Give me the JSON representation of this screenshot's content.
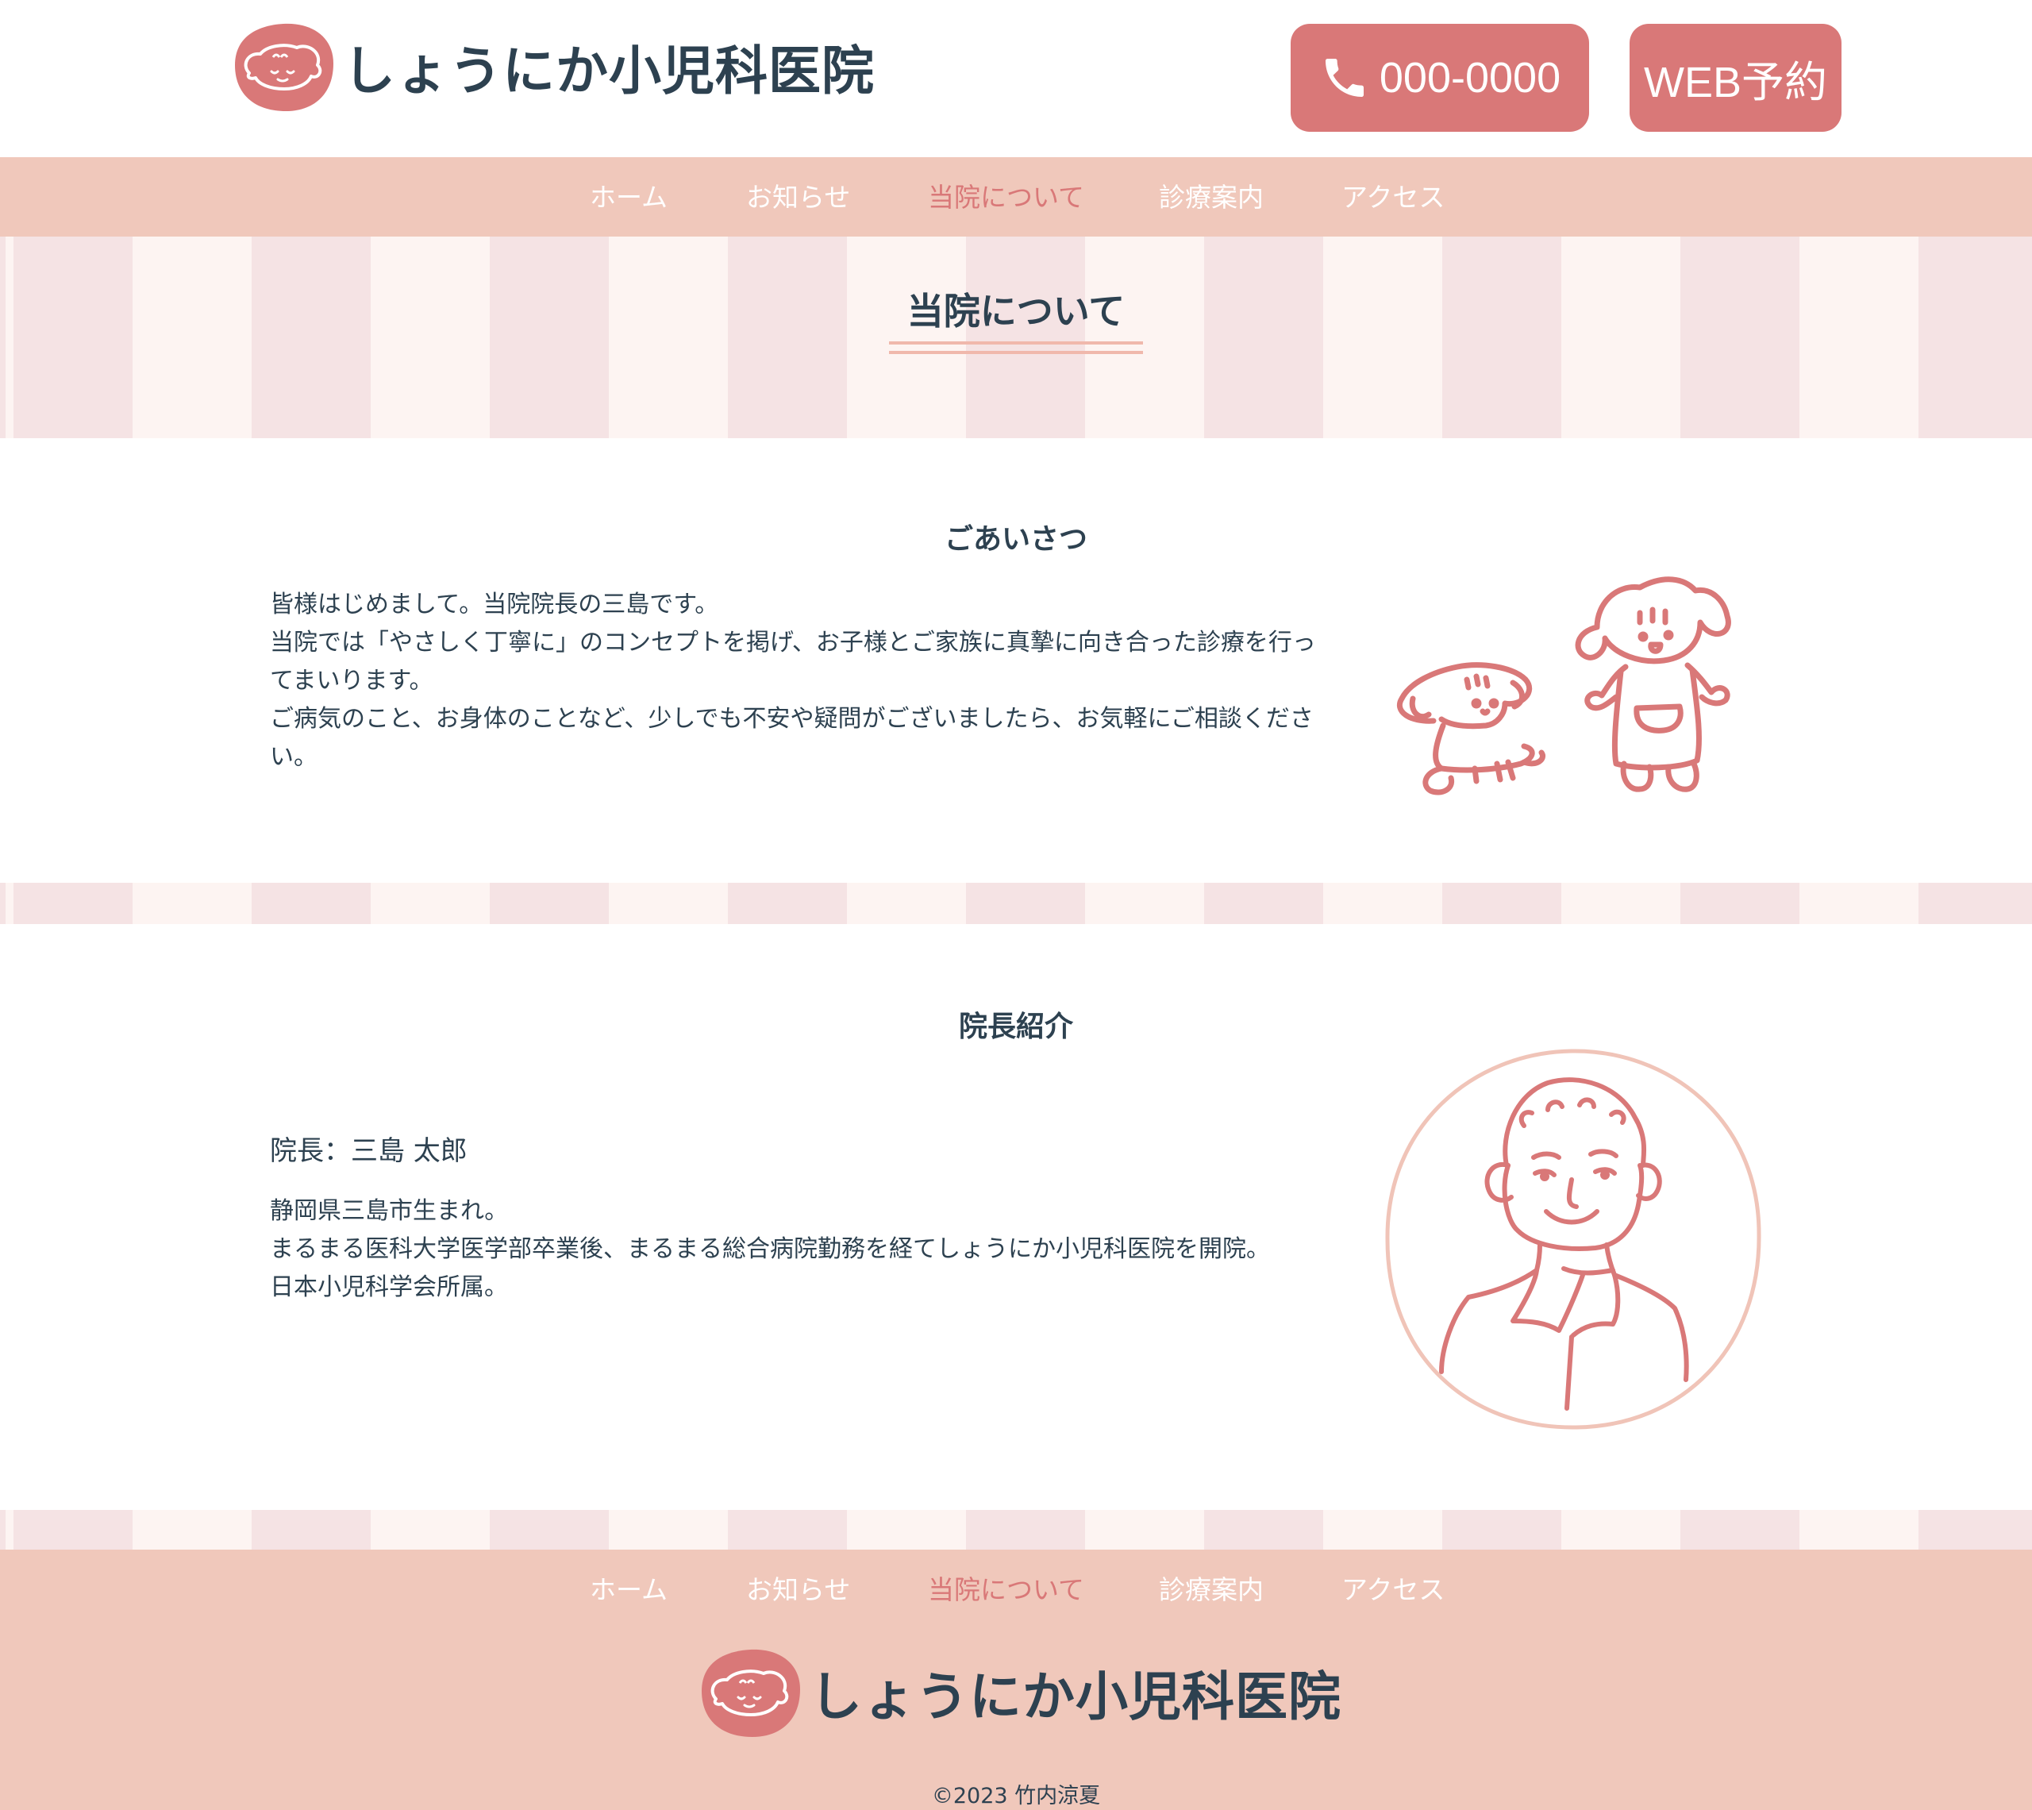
{
  "header": {
    "logo_text": "しょうにか小児科医院",
    "tel_label": "000-0000",
    "web_label": "WEB予約"
  },
  "nav": {
    "items": [
      {
        "label": "ホーム"
      },
      {
        "label": "お知らせ"
      },
      {
        "label": "当院について"
      },
      {
        "label": "診療案内"
      },
      {
        "label": "アクセス"
      }
    ],
    "active_index": 2
  },
  "hero": {
    "title": "当院について"
  },
  "greeting": {
    "title": "ごあいさつ",
    "lines": [
      "皆様はじめまして。当院院長の三島です。",
      "当院では「やさしく丁寧に」のコンセプトを掲げ、お子様とご家族に真摯に向き合った診療を行ってまいります。",
      "ご病気のこと、お身体のことなど、少しでも不安や疑問がございましたら、お気軽にご相談ください。"
    ]
  },
  "director": {
    "title": "院長紹介",
    "name": "院長：三島 太郎",
    "lines": [
      "静岡県三島市生まれ。",
      "まるまる医科大学医学部卒業後、まるまる総合病院勤務を経てしょうにか小児科医院を開院。",
      "日本小児科学会所属。"
    ]
  },
  "footer": {
    "logo_text": "しょうにか小児科医院",
    "copyright": "©2023 竹内涼夏"
  },
  "colors": {
    "accent": "#d97878",
    "nav_bg": "#f0c8bb",
    "text": "#2d4150",
    "stripe_a": "#f5e3e4",
    "stripe_b": "#fdf4f2"
  }
}
